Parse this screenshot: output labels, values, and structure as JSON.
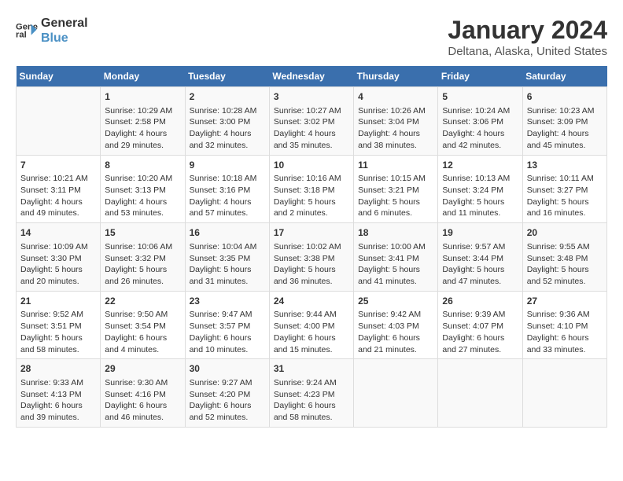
{
  "logo": {
    "line1": "General",
    "line2": "Blue"
  },
  "title": "January 2024",
  "subtitle": "Deltana, Alaska, United States",
  "header_color": "#3a6fad",
  "days_of_week": [
    "Sunday",
    "Monday",
    "Tuesday",
    "Wednesday",
    "Thursday",
    "Friday",
    "Saturday"
  ],
  "weeks": [
    [
      {
        "day": "",
        "info": ""
      },
      {
        "day": "1",
        "info": "Sunrise: 10:29 AM\nSunset: 2:58 PM\nDaylight: 4 hours\nand 29 minutes."
      },
      {
        "day": "2",
        "info": "Sunrise: 10:28 AM\nSunset: 3:00 PM\nDaylight: 4 hours\nand 32 minutes."
      },
      {
        "day": "3",
        "info": "Sunrise: 10:27 AM\nSunset: 3:02 PM\nDaylight: 4 hours\nand 35 minutes."
      },
      {
        "day": "4",
        "info": "Sunrise: 10:26 AM\nSunset: 3:04 PM\nDaylight: 4 hours\nand 38 minutes."
      },
      {
        "day": "5",
        "info": "Sunrise: 10:24 AM\nSunset: 3:06 PM\nDaylight: 4 hours\nand 42 minutes."
      },
      {
        "day": "6",
        "info": "Sunrise: 10:23 AM\nSunset: 3:09 PM\nDaylight: 4 hours\nand 45 minutes."
      }
    ],
    [
      {
        "day": "7",
        "info": "Sunrise: 10:21 AM\nSunset: 3:11 PM\nDaylight: 4 hours\nand 49 minutes."
      },
      {
        "day": "8",
        "info": "Sunrise: 10:20 AM\nSunset: 3:13 PM\nDaylight: 4 hours\nand 53 minutes."
      },
      {
        "day": "9",
        "info": "Sunrise: 10:18 AM\nSunset: 3:16 PM\nDaylight: 4 hours\nand 57 minutes."
      },
      {
        "day": "10",
        "info": "Sunrise: 10:16 AM\nSunset: 3:18 PM\nDaylight: 5 hours\nand 2 minutes."
      },
      {
        "day": "11",
        "info": "Sunrise: 10:15 AM\nSunset: 3:21 PM\nDaylight: 5 hours\nand 6 minutes."
      },
      {
        "day": "12",
        "info": "Sunrise: 10:13 AM\nSunset: 3:24 PM\nDaylight: 5 hours\nand 11 minutes."
      },
      {
        "day": "13",
        "info": "Sunrise: 10:11 AM\nSunset: 3:27 PM\nDaylight: 5 hours\nand 16 minutes."
      }
    ],
    [
      {
        "day": "14",
        "info": "Sunrise: 10:09 AM\nSunset: 3:30 PM\nDaylight: 5 hours\nand 20 minutes."
      },
      {
        "day": "15",
        "info": "Sunrise: 10:06 AM\nSunset: 3:32 PM\nDaylight: 5 hours\nand 26 minutes."
      },
      {
        "day": "16",
        "info": "Sunrise: 10:04 AM\nSunset: 3:35 PM\nDaylight: 5 hours\nand 31 minutes."
      },
      {
        "day": "17",
        "info": "Sunrise: 10:02 AM\nSunset: 3:38 PM\nDaylight: 5 hours\nand 36 minutes."
      },
      {
        "day": "18",
        "info": "Sunrise: 10:00 AM\nSunset: 3:41 PM\nDaylight: 5 hours\nand 41 minutes."
      },
      {
        "day": "19",
        "info": "Sunrise: 9:57 AM\nSunset: 3:44 PM\nDaylight: 5 hours\nand 47 minutes."
      },
      {
        "day": "20",
        "info": "Sunrise: 9:55 AM\nSunset: 3:48 PM\nDaylight: 5 hours\nand 52 minutes."
      }
    ],
    [
      {
        "day": "21",
        "info": "Sunrise: 9:52 AM\nSunset: 3:51 PM\nDaylight: 5 hours\nand 58 minutes."
      },
      {
        "day": "22",
        "info": "Sunrise: 9:50 AM\nSunset: 3:54 PM\nDaylight: 6 hours\nand 4 minutes."
      },
      {
        "day": "23",
        "info": "Sunrise: 9:47 AM\nSunset: 3:57 PM\nDaylight: 6 hours\nand 10 minutes."
      },
      {
        "day": "24",
        "info": "Sunrise: 9:44 AM\nSunset: 4:00 PM\nDaylight: 6 hours\nand 15 minutes."
      },
      {
        "day": "25",
        "info": "Sunrise: 9:42 AM\nSunset: 4:03 PM\nDaylight: 6 hours\nand 21 minutes."
      },
      {
        "day": "26",
        "info": "Sunrise: 9:39 AM\nSunset: 4:07 PM\nDaylight: 6 hours\nand 27 minutes."
      },
      {
        "day": "27",
        "info": "Sunrise: 9:36 AM\nSunset: 4:10 PM\nDaylight: 6 hours\nand 33 minutes."
      }
    ],
    [
      {
        "day": "28",
        "info": "Sunrise: 9:33 AM\nSunset: 4:13 PM\nDaylight: 6 hours\nand 39 minutes."
      },
      {
        "day": "29",
        "info": "Sunrise: 9:30 AM\nSunset: 4:16 PM\nDaylight: 6 hours\nand 46 minutes."
      },
      {
        "day": "30",
        "info": "Sunrise: 9:27 AM\nSunset: 4:20 PM\nDaylight: 6 hours\nand 52 minutes."
      },
      {
        "day": "31",
        "info": "Sunrise: 9:24 AM\nSunset: 4:23 PM\nDaylight: 6 hours\nand 58 minutes."
      },
      {
        "day": "",
        "info": ""
      },
      {
        "day": "",
        "info": ""
      },
      {
        "day": "",
        "info": ""
      }
    ]
  ]
}
